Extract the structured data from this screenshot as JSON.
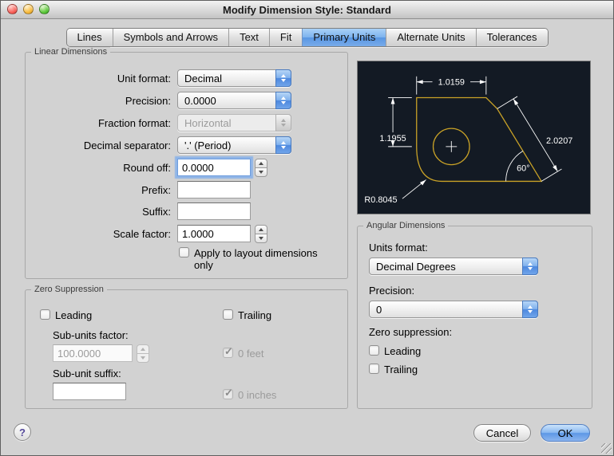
{
  "colors": {
    "accent_blue": "#5d98e6",
    "tab_highlight": "#7cb2ee",
    "preview_background": "#131a24",
    "drawing_gold": "#c9a227",
    "dimension_white": "#ffffff"
  },
  "window": {
    "title": "Modify Dimension Style: Standard"
  },
  "tabs": [
    {
      "label": "Lines"
    },
    {
      "label": "Symbols and Arrows"
    },
    {
      "label": "Text"
    },
    {
      "label": "Fit"
    },
    {
      "label": "Primary Units",
      "active": true
    },
    {
      "label": "Alternate Units"
    },
    {
      "label": "Tolerances"
    }
  ],
  "linear": {
    "title": "Linear Dimensions",
    "unit_format_label": "Unit format:",
    "unit_format_value": "Decimal",
    "precision_label": "Precision:",
    "precision_value": "0.0000",
    "fraction_format_label": "Fraction format:",
    "fraction_format_value": "Horizontal",
    "decimal_separator_label": "Decimal separator:",
    "decimal_separator_value": "'.' (Period)",
    "round_off_label": "Round off:",
    "round_off_value": "0.0000",
    "prefix_label": "Prefix:",
    "prefix_value": "",
    "suffix_label": "Suffix:",
    "suffix_value": "",
    "scale_factor_label": "Scale factor:",
    "scale_factor_value": "1.0000",
    "apply_layout_label": "Apply to layout dimensions only"
  },
  "zero_suppression": {
    "title": "Zero Suppression",
    "leading_label": "Leading",
    "trailing_label": "Trailing",
    "sub_units_factor_label": "Sub-units factor:",
    "sub_units_factor_value": "100.0000",
    "zero_feet_label": "0 feet",
    "sub_unit_suffix_label": "Sub-unit suffix:",
    "sub_unit_suffix_value": "",
    "zero_inches_label": "0 inches"
  },
  "preview": {
    "dim_top": "1.0159",
    "dim_left": "1.1955",
    "dim_diagonal": "2.0207",
    "dim_angle": "60°",
    "dim_radius": "R0.8045"
  },
  "angular": {
    "title": "Angular Dimensions",
    "units_format_label": "Units format:",
    "units_format_value": "Decimal Degrees",
    "precision_label": "Precision:",
    "precision_value": "0",
    "zero_suppression_label": "Zero suppression:",
    "leading_label": "Leading",
    "trailing_label": "Trailing"
  },
  "footer": {
    "help_label": "?",
    "cancel_label": "Cancel",
    "ok_label": "OK"
  }
}
